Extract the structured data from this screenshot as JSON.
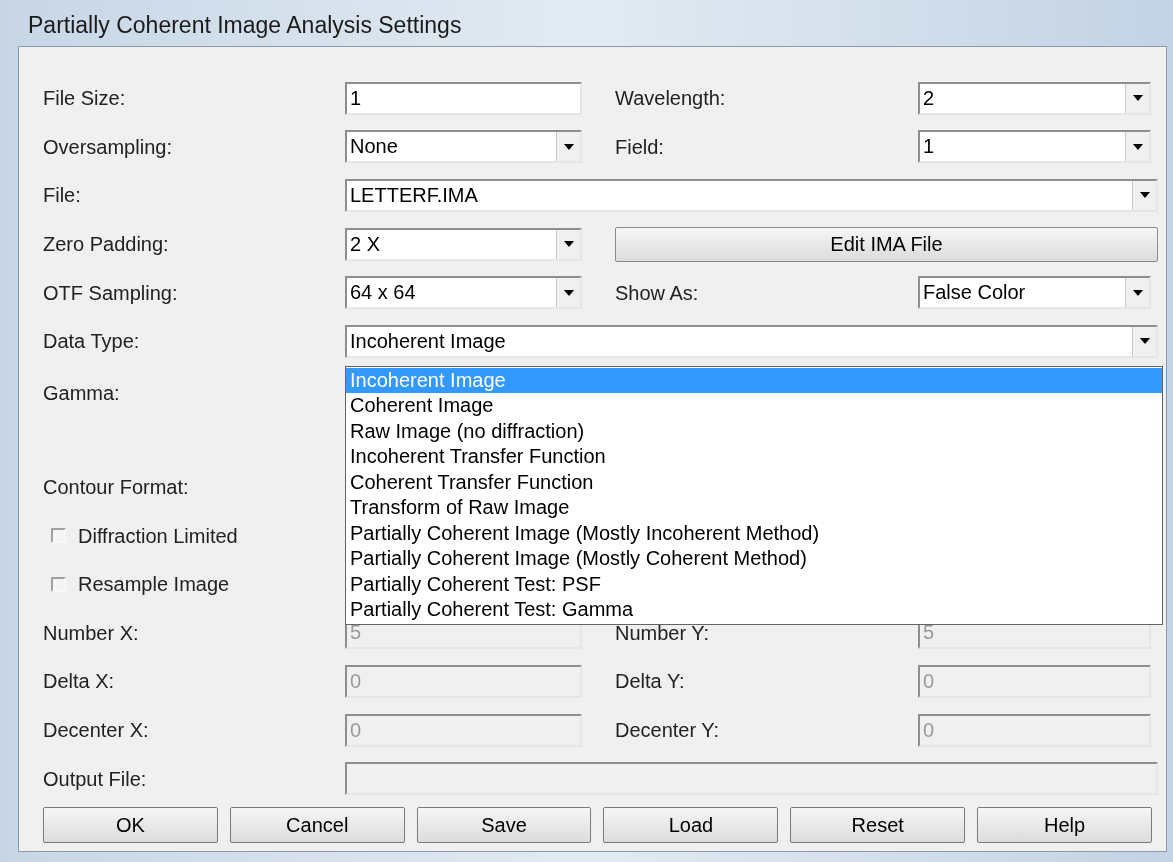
{
  "window": {
    "title": "Partially Coherent Image Analysis Settings"
  },
  "rows": [
    {
      "left": {
        "kind": "text",
        "label": "File Size:",
        "value": "1",
        "disabled": false
      },
      "right": {
        "kind": "combo",
        "label": "Wavelength:",
        "value": "2"
      }
    },
    {
      "left": {
        "kind": "combo",
        "label": "Oversampling:",
        "value": "None"
      },
      "right": {
        "kind": "combo",
        "label": "Field:",
        "value": "1"
      }
    },
    {
      "full": {
        "kind": "combo",
        "label": "File:",
        "value": "LETTERF.IMA"
      }
    },
    {
      "left": {
        "kind": "combo",
        "label": "Zero Padding:",
        "value": "2 X"
      },
      "right": {
        "kind": "button",
        "label": "Edit IMA File"
      }
    },
    {
      "left": {
        "kind": "combo",
        "label": "OTF Sampling:",
        "value": "64 x 64"
      },
      "right": {
        "kind": "combo",
        "label": "Show As:",
        "value": "False Color"
      }
    },
    {
      "full": {
        "kind": "open_combo",
        "label": "Data Type:",
        "value": "Incoherent Image"
      }
    },
    {
      "left": {
        "kind": "tall_label",
        "label": "Gamma:"
      }
    },
    {
      "left": {
        "kind": "label",
        "label": "Contour Format:"
      }
    },
    {
      "left": {
        "kind": "checkbox",
        "label": "Diffraction Limited",
        "checked": false
      }
    },
    {
      "left": {
        "kind": "checkbox",
        "label": "Resample Image",
        "checked": false
      }
    },
    {
      "left": {
        "kind": "text",
        "label": "Number X:",
        "value": "5",
        "disabled": true
      },
      "right": {
        "kind": "text",
        "label": "Number Y:",
        "value": "5",
        "disabled": true
      }
    },
    {
      "left": {
        "kind": "text",
        "label": "Delta X:",
        "value": "0",
        "disabled": true
      },
      "right": {
        "kind": "text",
        "label": "Delta Y:",
        "value": "0",
        "disabled": true
      }
    },
    {
      "left": {
        "kind": "text",
        "label": "Decenter X:",
        "value": "0",
        "disabled": true
      },
      "right": {
        "kind": "text",
        "label": "Decenter Y:",
        "value": "0",
        "disabled": true
      }
    },
    {
      "full": {
        "kind": "text",
        "label": "Output File:",
        "disabled": true
      }
    }
  ],
  "dropdown_options": [
    {
      "label": "Incoherent Image",
      "selected": true
    },
    {
      "label": "Coherent Image",
      "selected": false
    },
    {
      "label": "Raw Image (no diffraction)",
      "selected": false
    },
    {
      "label": "Incoherent Transfer Function",
      "selected": false
    },
    {
      "label": "Coherent Transfer Function",
      "selected": false
    },
    {
      "label": "Transform of Raw Image",
      "selected": false
    },
    {
      "label": "Partially Coherent Image (Mostly Incoherent Method)",
      "selected": false
    },
    {
      "label": "Partially Coherent Image (Mostly Coherent Method)",
      "selected": false
    },
    {
      "label": "Partially Coherent Test: PSF",
      "selected": false
    },
    {
      "label": "Partially Coherent Test: Gamma",
      "selected": false
    }
  ],
  "buttons": [
    "OK",
    "Cancel",
    "Save",
    "Load",
    "Reset",
    "Help"
  ]
}
